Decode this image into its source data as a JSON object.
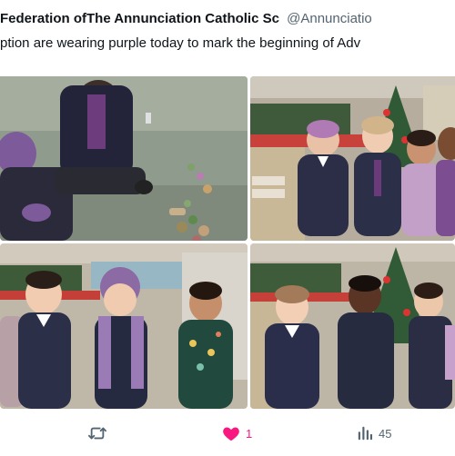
{
  "tweet": {
    "author_name": "Federation ofThe Annunciation Catholic Sc",
    "handle": "@Annunciatio",
    "text": "ption are wearing purple today to mark the beginning of Adv"
  },
  "media": {
    "photos": [
      {
        "name": "children-playing-on-carpet"
      },
      {
        "name": "children-by-christmas-tree"
      },
      {
        "name": "children-in-purple-scarves"
      },
      {
        "name": "children-with-wreath-display"
      }
    ]
  },
  "actions": {
    "retweet_icon": "retweet-icon",
    "retweet_count": "",
    "like_icon": "heart-icon",
    "like_count": "1",
    "like_color": "#f91880",
    "views_icon": "views-icon",
    "views_count": "45"
  },
  "colors": {
    "text": "#0f1419",
    "secondary": "#536471",
    "like": "#f91880"
  }
}
